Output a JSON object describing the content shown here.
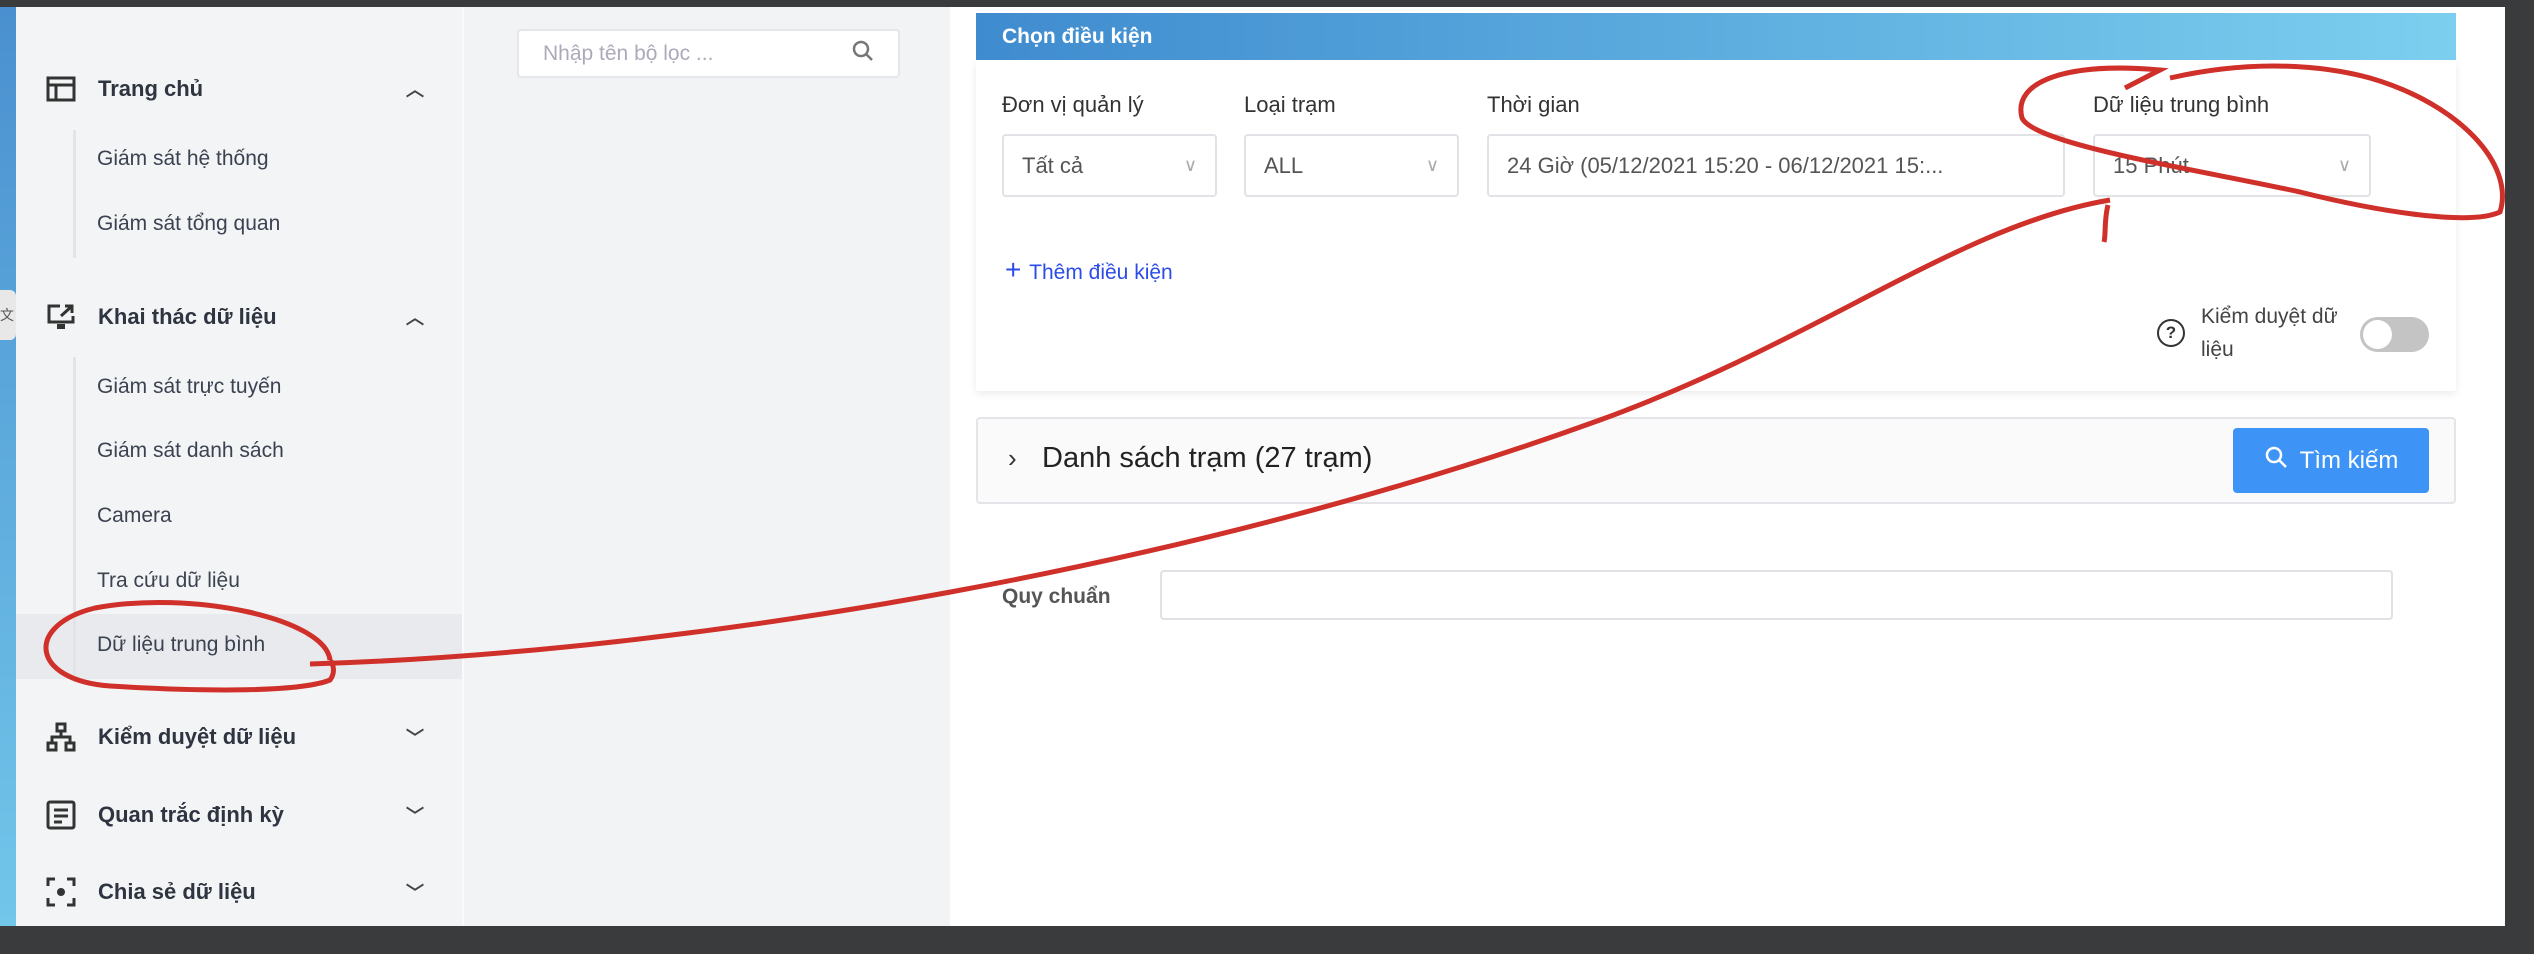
{
  "sidebar": {
    "groups": [
      {
        "label": "Trang chủ",
        "icon": "layout-icon",
        "expanded": true,
        "items": [
          "Giám sát hệ thống",
          "Giám sát tổng quan"
        ]
      },
      {
        "label": "Khai thác dữ liệu",
        "icon": "monitor-share-icon",
        "expanded": true,
        "items": [
          "Giám sát trực tuyến",
          "Giám sát danh sách",
          "Camera",
          "Tra cứu dữ liệu",
          "Dữ liệu trung bình"
        ]
      },
      {
        "label": "Kiểm duyệt dữ liệu",
        "icon": "hierarchy-icon",
        "expanded": false
      },
      {
        "label": "Quan trắc định kỳ",
        "icon": "document-icon",
        "expanded": false
      },
      {
        "label": "Chia sẻ dữ liệu",
        "icon": "focus-icon",
        "expanded": false
      }
    ],
    "active_item": "Dữ liệu trung bình"
  },
  "filter_search": {
    "placeholder": "Nhập tên bộ lọc ..."
  },
  "conditions": {
    "title": "Chọn điều kiện",
    "fields": [
      {
        "label": "Đơn vị quản lý",
        "value": "Tất cả"
      },
      {
        "label": "Loại trạm",
        "value": "ALL"
      },
      {
        "label": "Thời gian",
        "value": "24 Giờ (05/12/2021 15:20 - 06/12/2021 15:..."
      },
      {
        "label": "Dữ liệu trung bình",
        "value": "15 Phút"
      }
    ],
    "add_condition": "Thêm điều kiện",
    "review_label": "Kiểm duyệt dữ liệu",
    "review_enabled": false
  },
  "station_panel": {
    "title": "Danh sách trạm (27 trạm)",
    "search_button": "Tìm kiếm"
  },
  "standard": {
    "label": "Quy chuẩn",
    "value": ""
  },
  "colors": {
    "accent": "#3d94f6",
    "header_start": "#3f8bcf",
    "header_end": "#7ccfef",
    "annotation": "#d0302a"
  }
}
